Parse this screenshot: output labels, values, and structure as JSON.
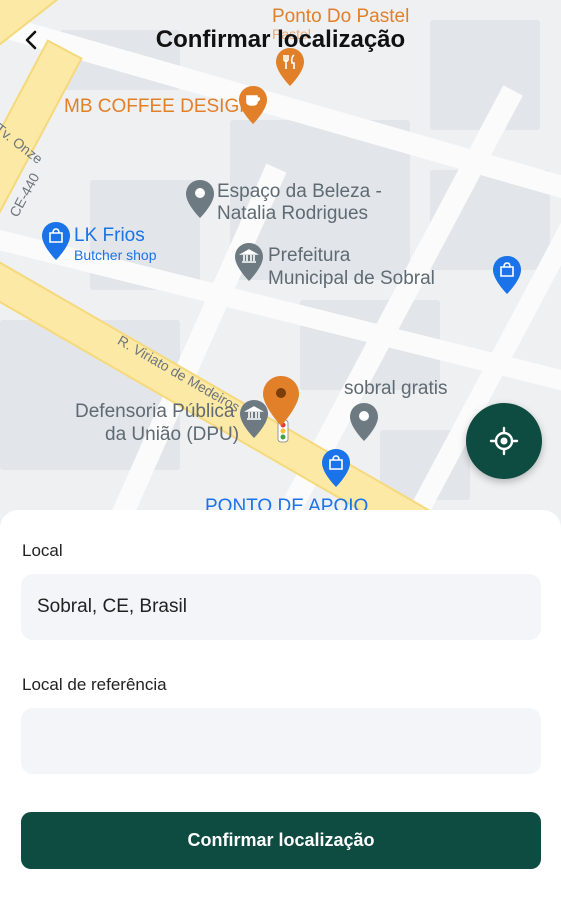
{
  "header": {
    "title": "Confirmar localização"
  },
  "map": {
    "places": {
      "pastel": "Ponto Do Pastel",
      "pastel_sub": "Pastel",
      "coffee": "MB COFFEE DESIGN",
      "tv_onze": "Tv. Onze",
      "ce440": "CE-440",
      "beleza_1": "Espaço da Beleza -",
      "beleza_2": "Natalia Rodrigues",
      "lkfrios": "LK Frios",
      "lkfrios_sub": "Butcher shop",
      "prefeitura_1": "Prefeitura",
      "prefeitura_2": "Municipal de Sobral",
      "viriato": "R. Viriato de Medeiros",
      "sobral_gratis": "sobral gratis",
      "defensoria_1": "Defensoria Pública",
      "defensoria_2": "da União (DPU)",
      "apoio": "PONTO DE APOIO"
    },
    "colors": {
      "pin_orange": "#e27f29",
      "poi_grey": "#6e7a82",
      "poi_blue": "#1a73e8",
      "accent": "#0e4b40"
    }
  },
  "form": {
    "local_label": "Local",
    "local_value": "Sobral, CE, Brasil",
    "reference_label": "Local de referência",
    "reference_value": "",
    "confirm_label": "Confirmar localização"
  }
}
